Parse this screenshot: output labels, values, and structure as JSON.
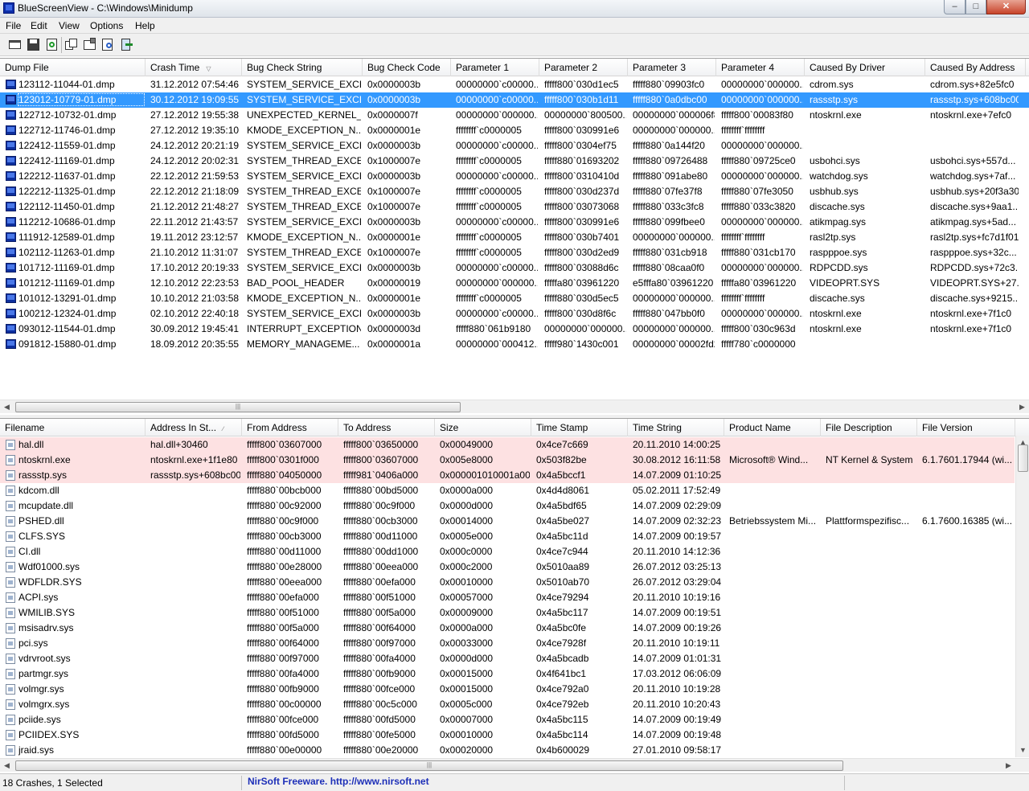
{
  "window": {
    "title": "BlueScreenView  -  C:\\Windows\\Minidump",
    "min": "–",
    "max": "□",
    "close": "✕"
  },
  "menu": [
    "File",
    "Edit",
    "View",
    "Options",
    "Help"
  ],
  "toolbar": [
    "save-report-icon",
    "save-icon",
    "refresh-icon",
    "copy-icon",
    "properties-icon",
    "find-icon",
    "exit-icon"
  ],
  "dumps": {
    "columns": [
      "Dump File",
      "Crash Time",
      "Bug Check String",
      "Bug Check Code",
      "Parameter 1",
      "Parameter 2",
      "Parameter 3",
      "Parameter 4",
      "Caused By Driver",
      "Caused By Address"
    ],
    "sort_glyph": "▽",
    "rows": [
      [
        "123112-11044-01.dmp",
        "31.12.2012 07:54:46",
        "SYSTEM_SERVICE_EXCE...",
        "0x0000003b",
        "00000000`c00000...",
        "fffff800`030d1ec5",
        "fffff880`09903fc0",
        "00000000`000000...",
        "cdrom.sys",
        "cdrom.sys+82e5fc0"
      ],
      [
        "123012-10779-01.dmp",
        "30.12.2012 19:09:55",
        "SYSTEM_SERVICE_EXCE...",
        "0x0000003b",
        "00000000`c00000...",
        "fffff800`030b1d11",
        "fffff880`0a0dbc00",
        "00000000`000000...",
        "rassstp.sys",
        "rassstp.sys+608bc00"
      ],
      [
        "122712-10732-01.dmp",
        "27.12.2012 19:55:38",
        "UNEXPECTED_KERNEL_...",
        "0x0000007f",
        "00000000`000000...",
        "00000000`800500...",
        "00000000`000006f8",
        "fffff800`00083f80",
        "ntoskrnl.exe",
        "ntoskrnl.exe+7efc0"
      ],
      [
        "122712-11746-01.dmp",
        "27.12.2012 19:35:10",
        "KMODE_EXCEPTION_N...",
        "0x0000001e",
        "ffffffff`c0000005",
        "fffff800`030991e6",
        "00000000`000000...",
        "ffffffff`ffffffff",
        "",
        ""
      ],
      [
        "122412-11559-01.dmp",
        "24.12.2012 20:21:19",
        "SYSTEM_SERVICE_EXCE...",
        "0x0000003b",
        "00000000`c00000...",
        "fffff800`0304ef75",
        "fffff880`0a144f20",
        "00000000`000000...",
        "",
        ""
      ],
      [
        "122412-11169-01.dmp",
        "24.12.2012 20:02:31",
        "SYSTEM_THREAD_EXCE...",
        "0x1000007e",
        "ffffffff`c0000005",
        "fffff880`01693202",
        "fffff880`09726488",
        "fffff880`09725ce0",
        "usbohci.sys",
        "usbohci.sys+557d..."
      ],
      [
        "122212-11637-01.dmp",
        "22.12.2012 21:59:53",
        "SYSTEM_SERVICE_EXCE...",
        "0x0000003b",
        "00000000`c00000...",
        "fffff800`0310410d",
        "fffff880`091abe80",
        "00000000`000000...",
        "watchdog.sys",
        "watchdog.sys+7af..."
      ],
      [
        "122212-11325-01.dmp",
        "22.12.2012 21:18:09",
        "SYSTEM_THREAD_EXCE...",
        "0x1000007e",
        "ffffffff`c0000005",
        "fffff800`030d237d",
        "fffff880`07fe37f8",
        "fffff880`07fe3050",
        "usbhub.sys",
        "usbhub.sys+20f3a30"
      ],
      [
        "122112-11450-01.dmp",
        "21.12.2012 21:48:27",
        "SYSTEM_THREAD_EXCE...",
        "0x1000007e",
        "ffffffff`c0000005",
        "fffff800`03073068",
        "fffff880`033c3fc8",
        "fffff880`033c3820",
        "discache.sys",
        "discache.sys+9aa1..."
      ],
      [
        "112212-10686-01.dmp",
        "22.11.2012 21:43:57",
        "SYSTEM_SERVICE_EXCE...",
        "0x0000003b",
        "00000000`c00000...",
        "fffff800`030991e6",
        "fffff880`099fbee0",
        "00000000`000000...",
        "atikmpag.sys",
        "atikmpag.sys+5ad..."
      ],
      [
        "111912-12589-01.dmp",
        "19.11.2012 23:12:57",
        "KMODE_EXCEPTION_N...",
        "0x0000001e",
        "ffffffff`c0000005",
        "fffff800`030b7401",
        "00000000`000000...",
        "ffffffff`ffffffff",
        "rasl2tp.sys",
        "rasl2tp.sys+fc7d1f01"
      ],
      [
        "102112-11263-01.dmp",
        "21.10.2012 11:31:07",
        "SYSTEM_THREAD_EXCE...",
        "0x1000007e",
        "ffffffff`c0000005",
        "fffff800`030d2ed9",
        "fffff880`031cb918",
        "fffff880`031cb170",
        "raspppoe.sys",
        "raspppoe.sys+32c..."
      ],
      [
        "101712-11169-01.dmp",
        "17.10.2012 20:19:33",
        "SYSTEM_SERVICE_EXCE...",
        "0x0000003b",
        "00000000`c00000...",
        "fffff800`03088d6c",
        "fffff880`08caa0f0",
        "00000000`000000...",
        "RDPCDD.sys",
        "RDPCDD.sys+72c3..."
      ],
      [
        "101212-11169-01.dmp",
        "12.10.2012 22:23:53",
        "BAD_POOL_HEADER",
        "0x00000019",
        "00000000`000000...",
        "fffffa80`03961220",
        "e5fffa80`03961220",
        "fffffa80`03961220",
        "VIDEOPRT.SYS",
        "VIDEOPRT.SYS+27..."
      ],
      [
        "101012-13291-01.dmp",
        "10.10.2012 21:03:58",
        "KMODE_EXCEPTION_N...",
        "0x0000001e",
        "ffffffff`c0000005",
        "fffff880`030d5ec5",
        "00000000`000000...",
        "ffffffff`ffffffff",
        "discache.sys",
        "discache.sys+9215..."
      ],
      [
        "100212-12324-01.dmp",
        "02.10.2012 22:40:18",
        "SYSTEM_SERVICE_EXCE...",
        "0x0000003b",
        "00000000`c00000...",
        "fffff800`030d8f6c",
        "fffff880`047bb0f0",
        "00000000`000000...",
        "ntoskrnl.exe",
        "ntoskrnl.exe+7f1c0"
      ],
      [
        "093012-11544-01.dmp",
        "30.09.2012 19:45:41",
        "INTERRUPT_EXCEPTION...",
        "0x0000003d",
        "fffff880`061b9180",
        "00000000`000000...",
        "00000000`000000...",
        "fffff800`030c963d",
        "ntoskrnl.exe",
        "ntoskrnl.exe+7f1c0"
      ],
      [
        "091812-15880-01.dmp",
        "18.09.2012 20:35:55",
        "MEMORY_MANAGEME...",
        "0x0000001a",
        "00000000`000412...",
        "fffff980`1430c001",
        "00000000`00002fd2",
        "fffff780`c0000000",
        "",
        ""
      ]
    ]
  },
  "modules": {
    "columns": [
      "Filename",
      "Address In St...",
      "From Address",
      "To Address",
      "Size",
      "Time Stamp",
      "Time String",
      "Product Name",
      "File Description",
      "File Version"
    ],
    "sort_glyph": "∕",
    "rows": [
      [
        "hal.dll",
        "hal.dll+30460",
        "fffff800`03607000",
        "fffff800`03650000",
        "0x00049000",
        "0x4ce7c669",
        "20.11.2010 14:00:25",
        "",
        "",
        ""
      ],
      [
        "ntoskrnl.exe",
        "ntoskrnl.exe+1f1e80",
        "fffff800`0301f000",
        "fffff800`03607000",
        "0x005e8000",
        "0x503f82be",
        "30.08.2012 16:11:58",
        "Microsoft® Wind...",
        "NT Kernel & System",
        "6.1.7601.17944 (wi..."
      ],
      [
        "rassstp.sys",
        "rassstp.sys+608bc00",
        "fffff880`04050000",
        "fffff981`0406a000",
        "0x000001010001a000",
        "0x4a5bccf1",
        "14.07.2009 01:10:25",
        "",
        "",
        ""
      ],
      [
        "kdcom.dll",
        "",
        "fffff880`00bcb000",
        "fffff880`00bd5000",
        "0x0000a000",
        "0x4d4d8061",
        "05.02.2011 17:52:49",
        "",
        "",
        ""
      ],
      [
        "mcupdate.dll",
        "",
        "fffff880`00c92000",
        "fffff880`00c9f000",
        "0x0000d000",
        "0x4a5bdf65",
        "14.07.2009 02:29:09",
        "",
        "",
        ""
      ],
      [
        "PSHED.dll",
        "",
        "fffff880`00c9f000",
        "fffff880`00cb3000",
        "0x00014000",
        "0x4a5be027",
        "14.07.2009 02:32:23",
        "Betriebssystem Mi...",
        "Plattformspezifisc...",
        "6.1.7600.16385 (wi..."
      ],
      [
        "CLFS.SYS",
        "",
        "fffff880`00cb3000",
        "fffff880`00d11000",
        "0x0005e000",
        "0x4a5bc11d",
        "14.07.2009 00:19:57",
        "",
        "",
        ""
      ],
      [
        "CI.dll",
        "",
        "fffff880`00d11000",
        "fffff880`00dd1000",
        "0x000c0000",
        "0x4ce7c944",
        "20.11.2010 14:12:36",
        "",
        "",
        ""
      ],
      [
        "Wdf01000.sys",
        "",
        "fffff880`00e28000",
        "fffff880`00eea000",
        "0x000c2000",
        "0x5010aa89",
        "26.07.2012 03:25:13",
        "",
        "",
        ""
      ],
      [
        "WDFLDR.SYS",
        "",
        "fffff880`00eea000",
        "fffff880`00efa000",
        "0x00010000",
        "0x5010ab70",
        "26.07.2012 03:29:04",
        "",
        "",
        ""
      ],
      [
        "ACPI.sys",
        "",
        "fffff880`00efa000",
        "fffff880`00f51000",
        "0x00057000",
        "0x4ce79294",
        "20.11.2010 10:19:16",
        "",
        "",
        ""
      ],
      [
        "WMILIB.SYS",
        "",
        "fffff880`00f51000",
        "fffff880`00f5a000",
        "0x00009000",
        "0x4a5bc117",
        "14.07.2009 00:19:51",
        "",
        "",
        ""
      ],
      [
        "msisadrv.sys",
        "",
        "fffff880`00f5a000",
        "fffff880`00f64000",
        "0x0000a000",
        "0x4a5bc0fe",
        "14.07.2009 00:19:26",
        "",
        "",
        ""
      ],
      [
        "pci.sys",
        "",
        "fffff880`00f64000",
        "fffff880`00f97000",
        "0x00033000",
        "0x4ce7928f",
        "20.11.2010 10:19:11",
        "",
        "",
        ""
      ],
      [
        "vdrvroot.sys",
        "",
        "fffff880`00f97000",
        "fffff880`00fa4000",
        "0x0000d000",
        "0x4a5bcadb",
        "14.07.2009 01:01:31",
        "",
        "",
        ""
      ],
      [
        "partmgr.sys",
        "",
        "fffff880`00fa4000",
        "fffff880`00fb9000",
        "0x00015000",
        "0x4f641bc1",
        "17.03.2012 06:06:09",
        "",
        "",
        ""
      ],
      [
        "volmgr.sys",
        "",
        "fffff880`00fb9000",
        "fffff880`00fce000",
        "0x00015000",
        "0x4ce792a0",
        "20.11.2010 10:19:28",
        "",
        "",
        ""
      ],
      [
        "volmgrx.sys",
        "",
        "fffff880`00c00000",
        "fffff880`00c5c000",
        "0x0005c000",
        "0x4ce792eb",
        "20.11.2010 10:20:43",
        "",
        "",
        ""
      ],
      [
        "pciide.sys",
        "",
        "fffff880`00fce000",
        "fffff880`00fd5000",
        "0x00007000",
        "0x4a5bc115",
        "14.07.2009 00:19:49",
        "",
        "",
        ""
      ],
      [
        "PCIIDEX.SYS",
        "",
        "fffff880`00fd5000",
        "fffff880`00fe5000",
        "0x00010000",
        "0x4a5bc114",
        "14.07.2009 00:19:48",
        "",
        "",
        ""
      ],
      [
        "jraid.sys",
        "",
        "fffff880`00e00000",
        "fffff880`00e20000",
        "0x00020000",
        "0x4b600029",
        "27.01.2010 09:58:17",
        "",
        "",
        ""
      ]
    ]
  },
  "status": {
    "count": "18 Crashes, 1 Selected",
    "link": "NirSoft Freeware.  http://www.nirsoft.net"
  },
  "colors": {
    "selection": "#3399ff",
    "highlight": "#fde1e2",
    "link": "#1d2fb8"
  }
}
